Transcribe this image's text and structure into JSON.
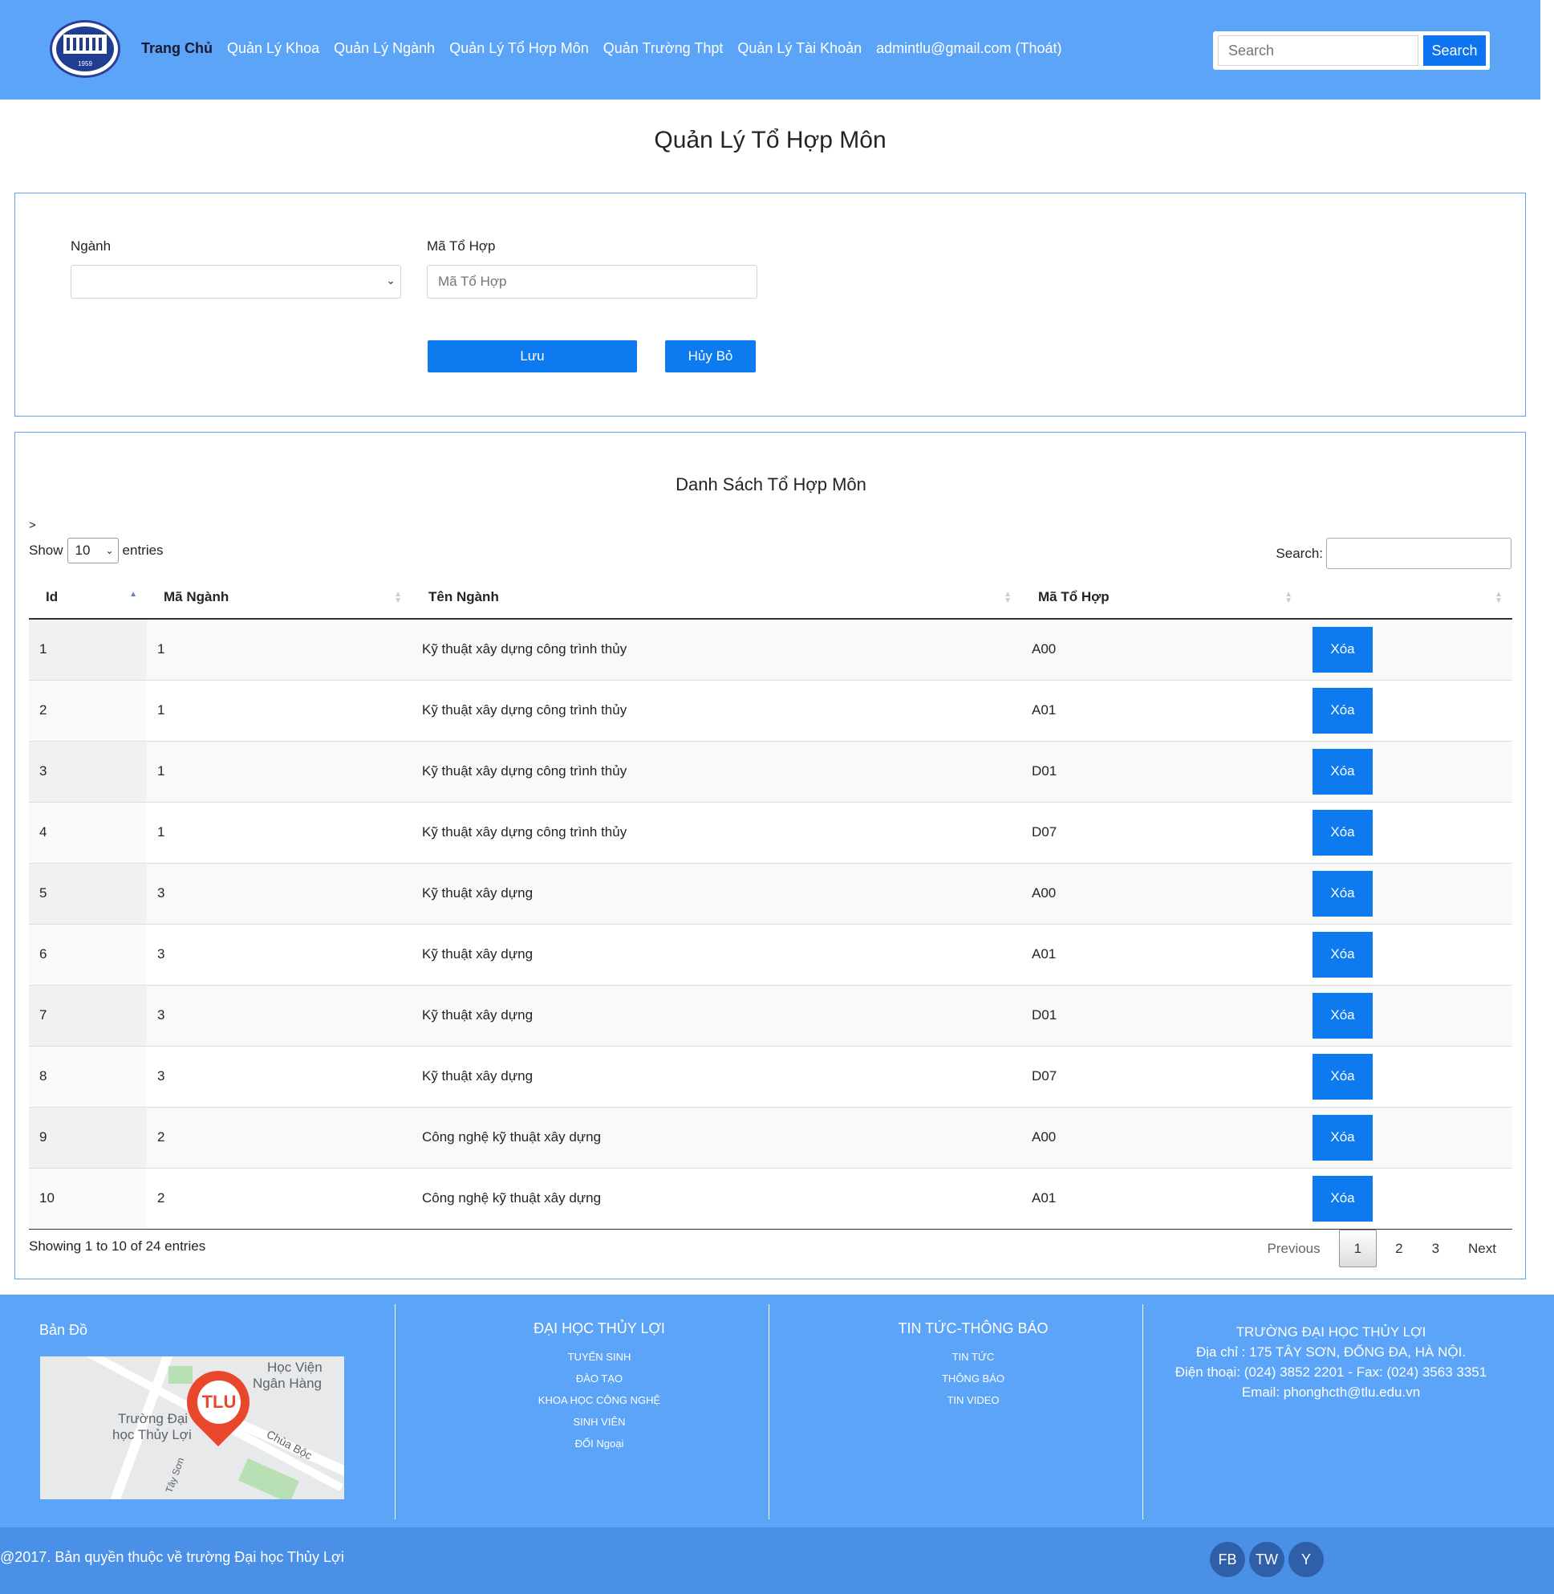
{
  "nav": {
    "logo_year": "1959",
    "links": [
      "Trang Chủ",
      "Quản Lý Khoa",
      "Quản Lý Ngành",
      "Quản Lý Tổ Hợp Môn",
      "Quản Trường Thpt",
      "Quản Lý Tài Khoản",
      "admintlu@gmail.com (Thoát)"
    ],
    "search_placeholder": "Search",
    "search_button": "Search"
  },
  "page_title": "Quản Lý Tổ Hợp Môn",
  "form": {
    "nganh_label": "Ngành",
    "nganh_value": "",
    "ma_to_hop_label": "Mã Tổ Hợp",
    "ma_to_hop_placeholder": "Mã Tổ Hợp",
    "save_button": "Lưu",
    "cancel_button": "Hủy Bỏ"
  },
  "list": {
    "title": "Danh Sách Tổ Hợp Môn",
    "stray_text": ">",
    "show_label": "Show",
    "page_length": "10",
    "entries_label": "entries",
    "search_label": "Search:",
    "columns": [
      "Id",
      "Mã Ngành",
      "Tên Ngành",
      "Mã Tổ Hợp",
      ""
    ],
    "delete_label": "Xóa",
    "rows": [
      {
        "id": "1",
        "ma_nganh": "1",
        "ten_nganh": "Kỹ thuật xây dựng công trình thủy",
        "ma_to_hop": "A00"
      },
      {
        "id": "2",
        "ma_nganh": "1",
        "ten_nganh": "Kỹ thuật xây dựng công trình thủy",
        "ma_to_hop": "A01"
      },
      {
        "id": "3",
        "ma_nganh": "1",
        "ten_nganh": "Kỹ thuật xây dựng công trình thủy",
        "ma_to_hop": "D01"
      },
      {
        "id": "4",
        "ma_nganh": "1",
        "ten_nganh": "Kỹ thuật xây dựng công trình thủy",
        "ma_to_hop": "D07"
      },
      {
        "id": "5",
        "ma_nganh": "3",
        "ten_nganh": "Kỹ thuật xây dựng",
        "ma_to_hop": "A00"
      },
      {
        "id": "6",
        "ma_nganh": "3",
        "ten_nganh": "Kỹ thuật xây dựng",
        "ma_to_hop": "A01"
      },
      {
        "id": "7",
        "ma_nganh": "3",
        "ten_nganh": "Kỹ thuật xây dựng",
        "ma_to_hop": "D01"
      },
      {
        "id": "8",
        "ma_nganh": "3",
        "ten_nganh": "Kỹ thuật xây dựng",
        "ma_to_hop": "D07"
      },
      {
        "id": "9",
        "ma_nganh": "2",
        "ten_nganh": "Công nghệ kỹ thuật xây dựng",
        "ma_to_hop": "A00"
      },
      {
        "id": "10",
        "ma_nganh": "2",
        "ten_nganh": "Công nghệ kỹ thuật xây dựng",
        "ma_to_hop": "A01"
      }
    ],
    "info": "Showing 1 to 10 of 24 entries",
    "pagination": {
      "previous": "Previous",
      "pages": [
        "1",
        "2",
        "3"
      ],
      "current": "1",
      "next": "Next"
    }
  },
  "footer": {
    "map_title": "Bản Đồ",
    "map_labels": {
      "place1": "Học Viện",
      "place1b": "Ngân Hàng",
      "place2": "Trường Đại",
      "place2b": "học Thủy Lợi",
      "street1": "Chùa Bộc",
      "street2": "Tây Sơn",
      "pin": "TLU"
    },
    "col2_title": "ĐẠI HỌC THỦY LỢI",
    "col2_links": [
      "TUYỂN SINH",
      "ĐÀO TẠO",
      "KHOA HỌC CÔNG NGHỆ",
      "SINH VIÊN",
      "ĐỐI Ngoại"
    ],
    "col3_title": "TIN TỨC-THÔNG BÁO",
    "col3_links": [
      "TIN TỨC",
      "THÔNG BÁO",
      "TIN VIDEO"
    ],
    "contact": {
      "name": "TRƯỜNG ĐẠI HỌC THỦY LỢI",
      "address": "Địa chỉ : 175 TÂY SƠN, ĐỐNG ĐA, HÀ NỘI.",
      "phone": "Điện thoại: (024) 3852 2201 - Fax: (024) 3563 3351",
      "email": "Email: phonghcth@tlu.edu.vn"
    },
    "copyright": "@2017. Bản quyền thuộc về trường Đại học Thủy Lợi",
    "social": [
      "FB",
      "TW",
      "Y"
    ]
  }
}
